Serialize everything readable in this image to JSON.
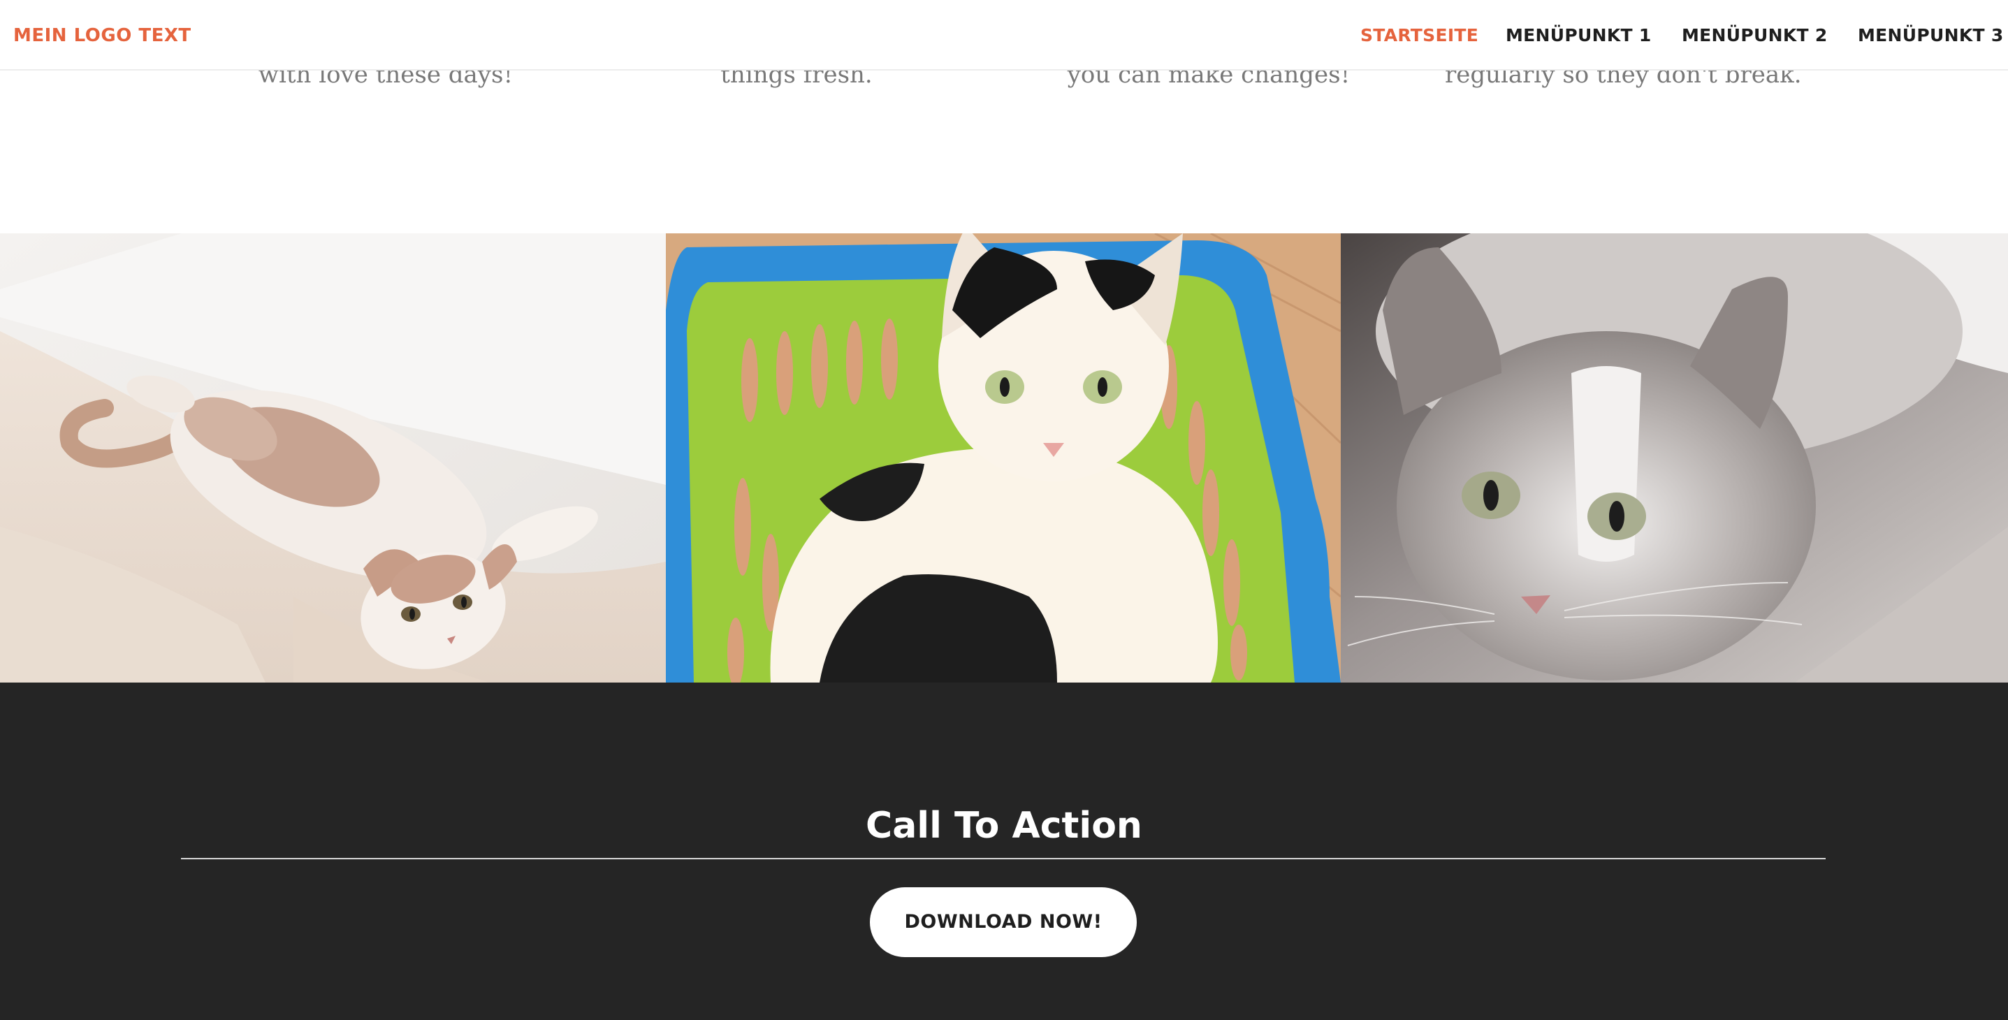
{
  "header": {
    "logo_text": "MEIN LOGO TEXT",
    "nav": [
      {
        "label": "STARTSEITE",
        "active": true
      },
      {
        "label": "MENÜPUNKT 1",
        "active": false
      },
      {
        "label": "MENÜPUNKT 2",
        "active": false
      },
      {
        "label": "MENÜPUNKT 3",
        "active": false
      }
    ]
  },
  "intro": {
    "columns": [
      "with love these days!",
      "things fresh.",
      "you can make changes!",
      "regularly so they don't break."
    ]
  },
  "gallery": {
    "images": [
      {
        "icon": "cat-lying-on-blanket-photo"
      },
      {
        "icon": "calico-cat-in-green-basket-photo"
      },
      {
        "icon": "grey-white-cat-closeup-photo"
      }
    ]
  },
  "cta": {
    "title": "Call To Action",
    "button_label": "DOWNLOAD NOW!"
  },
  "colors": {
    "accent": "#e5633d",
    "nav_text": "#1e1e1e",
    "cta_background": "#252525",
    "intro_text": "#787878"
  }
}
